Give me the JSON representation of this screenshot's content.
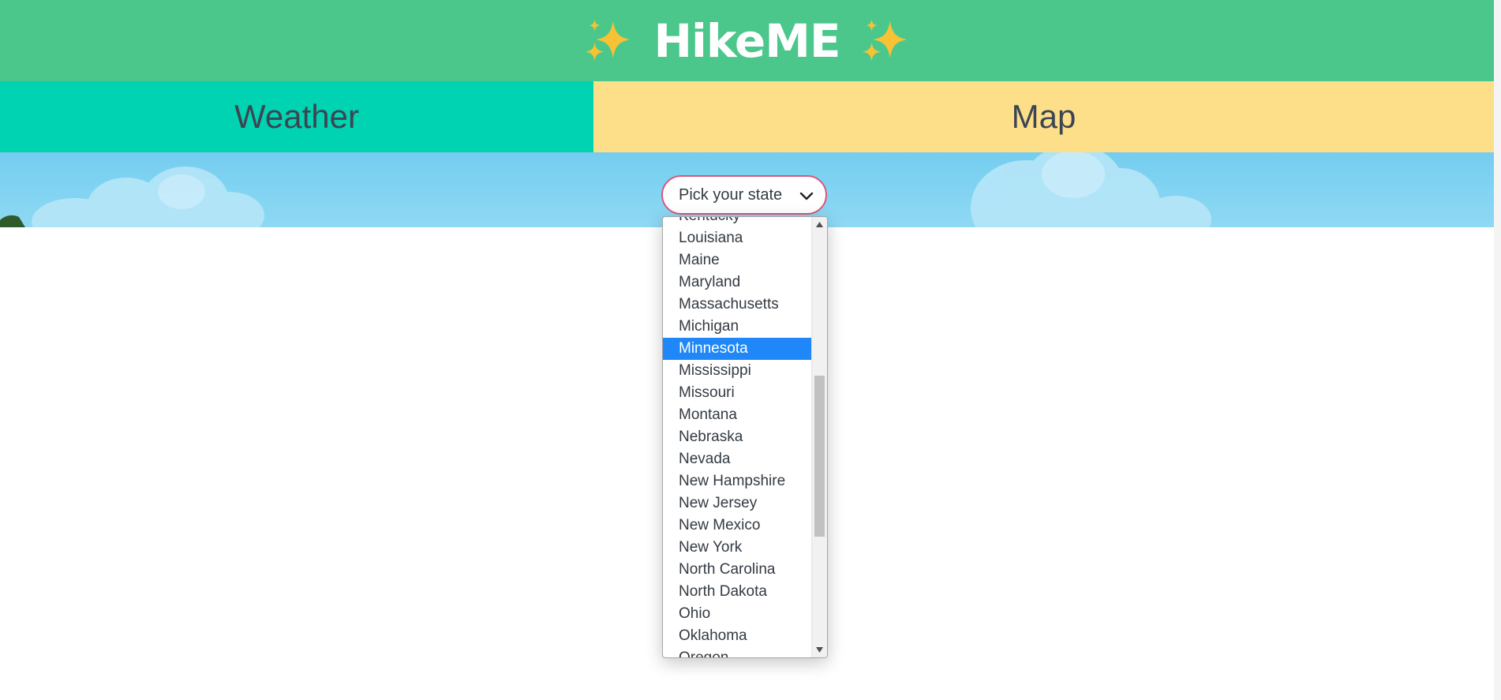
{
  "app": {
    "title": "HikeME",
    "sparkle_icon": "sparkles-icon",
    "colors": {
      "header": "#4bc78c",
      "weather_tab": "#00d3b2",
      "map_tab": "#fddf8a",
      "select_border": "#d9577c",
      "selected_option": "#1f87f7"
    }
  },
  "nav": {
    "weather_label": "Weather",
    "map_label": "Map"
  },
  "state_select": {
    "placeholder": "Pick your state",
    "chevron_icon": "chevron-down-icon",
    "selected": "Minnesota",
    "options": [
      "Kentucky",
      "Louisiana",
      "Maine",
      "Maryland",
      "Massachusetts",
      "Michigan",
      "Minnesota",
      "Mississippi",
      "Missouri",
      "Montana",
      "Nebraska",
      "Nevada",
      "New Hampshire",
      "New Jersey",
      "New Mexico",
      "New York",
      "North Carolina",
      "North Dakota",
      "Ohio",
      "Oklahoma",
      "Oregon"
    ]
  }
}
